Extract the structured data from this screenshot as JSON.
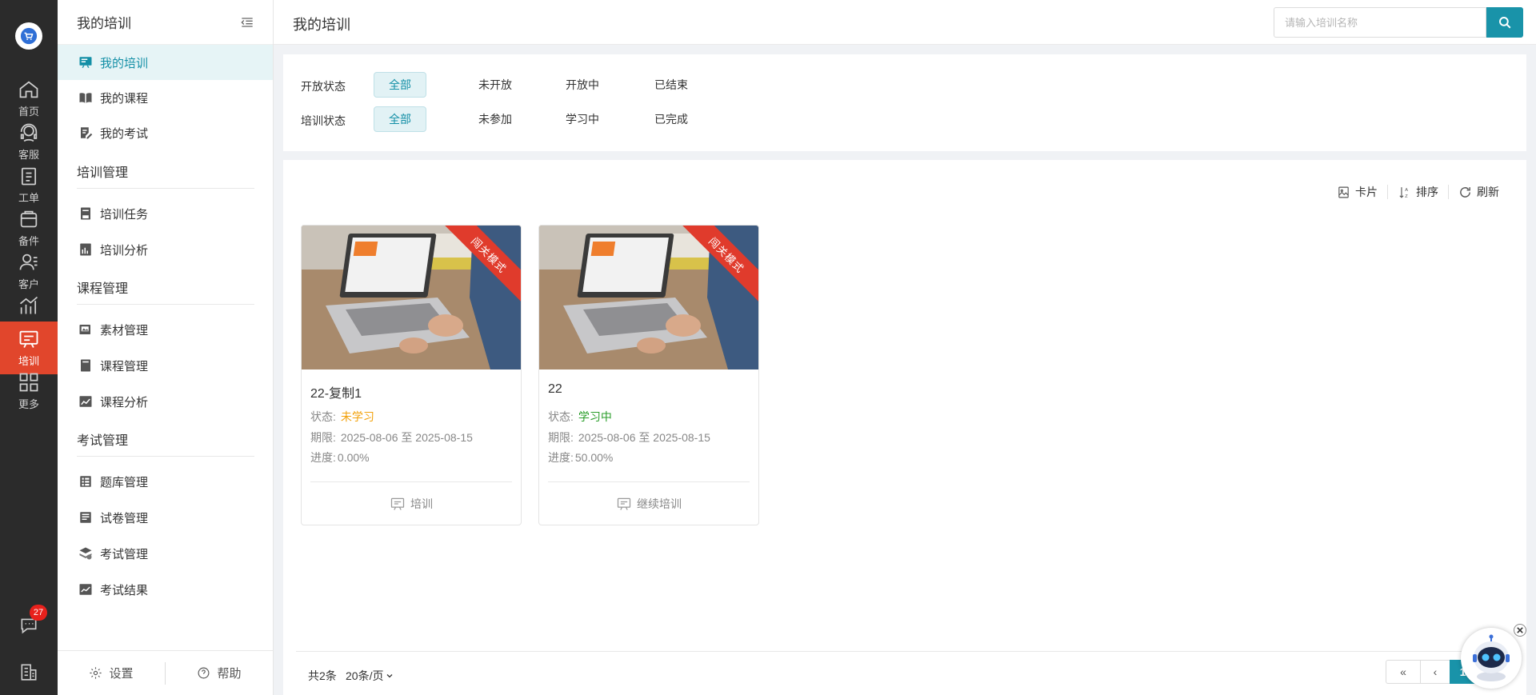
{
  "rail": {
    "items": [
      {
        "label": "首页",
        "icon": "home-icon"
      },
      {
        "label": "客服",
        "icon": "headset-icon"
      },
      {
        "label": "工单",
        "icon": "clipboard-icon"
      },
      {
        "label": "备件",
        "icon": "box-icon"
      },
      {
        "label": "客户",
        "icon": "customer-icon"
      },
      {
        "label": "报表",
        "icon": "bar-chart-icon"
      },
      {
        "label": "培训",
        "icon": "training-icon",
        "active": true
      },
      {
        "label": "更多",
        "icon": "grid-icon"
      }
    ],
    "message_badge": "27"
  },
  "sidebar": {
    "title": "我的培训",
    "items": [
      {
        "label": "我的培训",
        "active": true
      },
      {
        "label": "我的课程"
      },
      {
        "label": "我的考试"
      }
    ],
    "groups": [
      {
        "title": "培训管理",
        "items": [
          {
            "label": "培训任务"
          },
          {
            "label": "培训分析"
          }
        ]
      },
      {
        "title": "课程管理",
        "items": [
          {
            "label": "素材管理"
          },
          {
            "label": "课程管理"
          },
          {
            "label": "课程分析"
          }
        ]
      },
      {
        "title": "考试管理",
        "items": [
          {
            "label": "题库管理"
          },
          {
            "label": "试卷管理"
          },
          {
            "label": "考试管理"
          },
          {
            "label": "考试结果"
          }
        ]
      }
    ],
    "footer": {
      "settings": "设置",
      "help": "帮助"
    }
  },
  "header": {
    "title": "我的培训",
    "search_placeholder": "请输入培训名称"
  },
  "filters": {
    "open_status": {
      "label": "开放状态",
      "options": [
        "全部",
        "未开放",
        "开放中",
        "已结束"
      ],
      "selected": "全部"
    },
    "train_status": {
      "label": "培训状态",
      "options": [
        "全部",
        "未参加",
        "学习中",
        "已完成"
      ],
      "selected": "全部"
    }
  },
  "toolbar": {
    "card": "卡片",
    "sort": "排序",
    "refresh": "刷新"
  },
  "cards": [
    {
      "ribbon": "闯关模式",
      "title": "22-复制1",
      "status_label": "状态:",
      "status": "未学习",
      "status_color": "#f2a20c",
      "period_label": "期限:",
      "period": "2025-08-06 至 2025-08-15",
      "progress_label": "进度:",
      "progress": "0.00%",
      "action": "培训"
    },
    {
      "ribbon": "闯关模式",
      "title": "22",
      "status_label": "状态:",
      "status": "学习中",
      "status_color": "#2a9d2a",
      "period_label": "期限:",
      "period": "2025-08-06 至 2025-08-15",
      "progress_label": "进度:",
      "progress": "50.00%",
      "action": "继续培训"
    }
  ],
  "pagination": {
    "total": "共2条",
    "page_size": "20条/页",
    "current_page": "1",
    "first": "«",
    "prev": "‹",
    "next": "›"
  },
  "colors": {
    "accent": "#1993a9",
    "rail_bg": "#2b2b2b",
    "rail_active": "#e1462c",
    "ribbon": "#e03b2c"
  }
}
